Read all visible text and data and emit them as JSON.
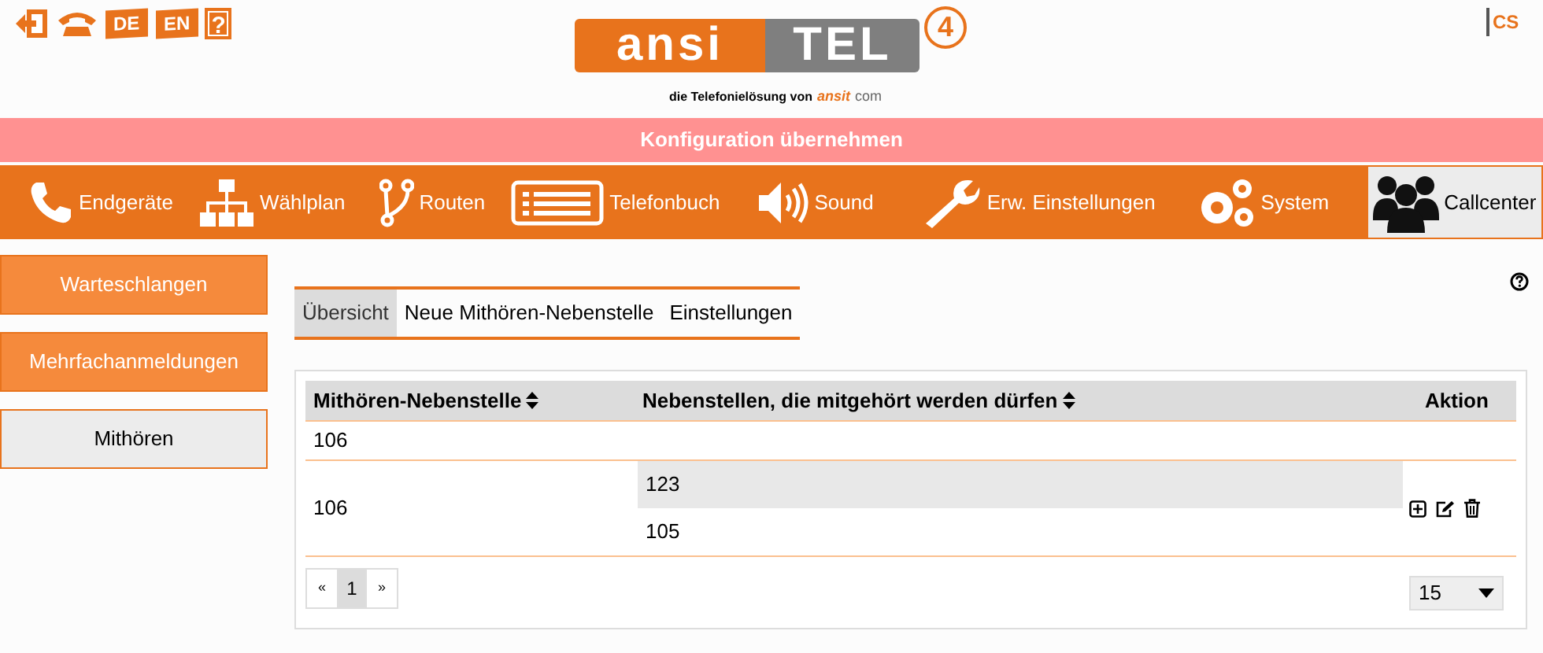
{
  "header": {
    "languages": [
      "DE",
      "EN"
    ],
    "help": "?",
    "logo": {
      "left": "ansi",
      "right": "TEL",
      "version": "4",
      "tagline": "die Telefonielösung von",
      "brand_left": "ansit",
      "brand_right": "com"
    },
    "corner_logo": "CS"
  },
  "apply_bar": "Konfiguration übernehmen",
  "nav": [
    {
      "label": "Endgeräte",
      "kind": "phone",
      "selected": false
    },
    {
      "label": "Wählplan",
      "kind": "tree",
      "selected": false
    },
    {
      "label": "Routen",
      "kind": "fork",
      "selected": false
    },
    {
      "label": "Telefonbuch",
      "kind": "list",
      "selected": false
    },
    {
      "label": "Sound",
      "kind": "speaker",
      "selected": false
    },
    {
      "label": "Erw. Einstellungen",
      "kind": "wrench",
      "selected": false
    },
    {
      "label": "System",
      "kind": "gears",
      "selected": false
    },
    {
      "label": "Callcenter",
      "kind": "people",
      "selected": true
    }
  ],
  "sidebar": [
    {
      "label": "Warteschlangen",
      "selected": false
    },
    {
      "label": "Mehrfachanmeldungen",
      "selected": false
    },
    {
      "label": "Mithören",
      "selected": true
    }
  ],
  "tabs": [
    {
      "label": "Übersicht",
      "selected": true
    },
    {
      "label": "Neue Mithören-Nebenstelle",
      "selected": false
    },
    {
      "label": "Einstellungen",
      "selected": false
    }
  ],
  "table": {
    "columns": [
      "Mithören-Nebenstelle",
      "Nebenstellen, die mitgehört werden dürfen",
      "Aktion"
    ],
    "rows": [
      {
        "extension": "106",
        "allowed": [],
        "actions": false
      },
      {
        "extension": "106",
        "allowed": [
          {
            "value": "123",
            "selected": true
          },
          {
            "value": "105",
            "selected": false
          }
        ],
        "actions": true
      }
    ]
  },
  "pagination": {
    "prev": "«",
    "pages": [
      {
        "label": "1",
        "selected": true
      }
    ],
    "next": "»"
  },
  "page_size": "15"
}
